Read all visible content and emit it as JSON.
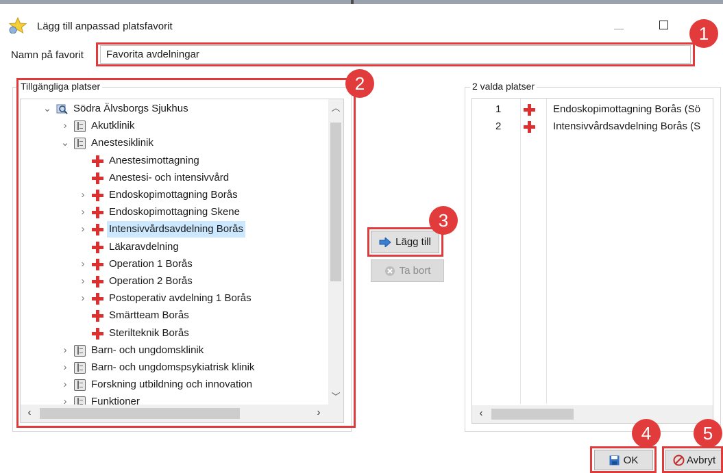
{
  "window": {
    "title": "Lägg till anpassad platsfavorit",
    "app_icon": "star-icon",
    "controls": [
      "minimize-icon",
      "maximize-icon"
    ]
  },
  "name_field": {
    "label": "Namn på favorit",
    "value": "Favorita avdelningar"
  },
  "available": {
    "group_title": "Tillgängliga platser",
    "tree": [
      {
        "label": "Södra Älvsborgs Sjukhus",
        "level": 0,
        "expander": "⌄",
        "icon": "hospital-search-icon"
      },
      {
        "label": "Akutklinik",
        "level": 1,
        "expander": "›",
        "icon": "book-icon"
      },
      {
        "label": "Anestesiklinik",
        "level": 1,
        "expander": "⌄",
        "icon": "book-icon"
      },
      {
        "label": "Anestesimottagning",
        "level": 2,
        "expander": "",
        "icon": "red-cross-icon"
      },
      {
        "label": "Anestesi- och intensivvård",
        "level": 2,
        "expander": "",
        "icon": "red-cross-icon"
      },
      {
        "label": "Endoskopimottagning Borås",
        "level": 2,
        "expander": "›",
        "icon": "red-cross-icon"
      },
      {
        "label": "Endoskopimottagning Skene",
        "level": 2,
        "expander": "›",
        "icon": "red-cross-icon"
      },
      {
        "label": "Intensivvårdsavdelning Borås",
        "level": 2,
        "expander": "›",
        "icon": "red-cross-icon",
        "selected": true
      },
      {
        "label": "Läkaravdelning",
        "level": 2,
        "expander": "",
        "icon": "red-cross-icon"
      },
      {
        "label": "Operation 1 Borås",
        "level": 2,
        "expander": "›",
        "icon": "red-cross-icon"
      },
      {
        "label": "Operation 2 Borås",
        "level": 2,
        "expander": "›",
        "icon": "red-cross-icon"
      },
      {
        "label": "Postoperativ avdelning 1 Borås",
        "level": 2,
        "expander": "›",
        "icon": "red-cross-icon"
      },
      {
        "label": "Smärtteam Borås",
        "level": 2,
        "expander": "",
        "icon": "red-cross-icon"
      },
      {
        "label": "Sterilteknik Borås",
        "level": 2,
        "expander": "",
        "icon": "red-cross-icon"
      },
      {
        "label": "Barn- och ungdomsklinik",
        "level": 1,
        "expander": "›",
        "icon": "book-icon"
      },
      {
        "label": "Barn- och ungdomspsykiatrisk klinik",
        "level": 1,
        "expander": "›",
        "icon": "book-icon"
      },
      {
        "label": "Forskning utbildning och innovation",
        "level": 1,
        "expander": "›",
        "icon": "book-icon"
      },
      {
        "label": "Funktioner",
        "level": 1,
        "expander": "›",
        "icon": "book-icon"
      }
    ]
  },
  "buttons": {
    "add": {
      "label": "Lägg till",
      "icon": "arrow-right-icon"
    },
    "remove": {
      "label": "Ta bort",
      "icon": "remove-circle-icon"
    },
    "ok": {
      "label": "OK",
      "icon": "save-icon"
    },
    "cancel": {
      "label": "Avbryt",
      "icon": "cancel-icon"
    }
  },
  "selected": {
    "group_title": "2 valda platser",
    "rows": [
      {
        "num": "1",
        "name": "Endoskopimottagning Borås (Sö"
      },
      {
        "num": "2",
        "name": "Intensivvårdsavdelning Borås (S"
      }
    ]
  },
  "callouts": [
    "1",
    "2",
    "3",
    "4",
    "5"
  ],
  "colors": {
    "callout_red": "#e23b3b",
    "selection_blue": "#cce8ff",
    "cross_red": "#dc2f2f"
  }
}
